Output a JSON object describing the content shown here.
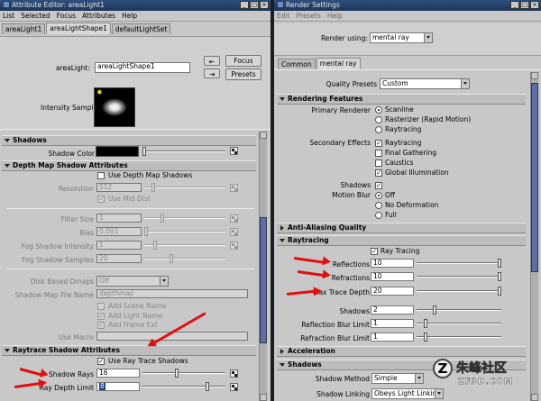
{
  "attribute_editor": {
    "title": "Attribute Editor: areaLight1",
    "menu": [
      "List",
      "Selected",
      "Focus",
      "Attributes",
      "Help"
    ],
    "tabs": [
      "areaLight1",
      "areaLightShape1",
      "defaultLightSet"
    ],
    "area_light_label": "areaLight:",
    "area_light_value": "areaLightShape1",
    "focus_button": "Focus",
    "presets_button": "Presets",
    "intensity_sample_label": "Intensity Sample",
    "shadows_section": "Shadows",
    "shadow_color_label": "Shadow Color",
    "depth_map_section": "Depth Map Shadow Attributes",
    "use_depth_map_label": "Use Depth Map Shadows",
    "resolution_label": "Resolution",
    "resolution_value": "512",
    "use_mid_dist_label": "Use Mid Dist",
    "filter_size_label": "Filter Size",
    "filter_size_value": "1",
    "bias_label": "Bias",
    "bias_value": "0.001",
    "fog_intensity_label": "Fog Shadow Intensity",
    "fog_intensity_value": "1",
    "fog_samples_label": "Fog Shadow Samples",
    "fog_samples_value": "20",
    "disk_based_label": "Disk Based Dmaps",
    "disk_based_value": "Off",
    "shadow_map_name_label": "Shadow Map File Name",
    "shadow_map_name_value": "depthmap",
    "add_scene_name_label": "Add Scene Name",
    "add_light_name_label": "Add Light Name",
    "add_frame_ext_label": "Add Frame Ext",
    "use_macro_label": "Use Macro",
    "raytrace_section": "Raytrace Shadow Attributes",
    "use_ray_trace_label": "Use Ray Trace Shadows",
    "shadow_rays_label": "Shadow Rays",
    "shadow_rays_value": "16",
    "ray_depth_label": "Ray Depth Limit",
    "ray_depth_value": "8"
  },
  "render_settings": {
    "title": "Render Settings",
    "menu": [
      "Edit",
      "Presets",
      "Help"
    ],
    "render_using_label": "Render using:",
    "render_using_value": "mental ray",
    "tabs": [
      "Common",
      "mental ray"
    ],
    "quality_presets_label": "Quality Presets",
    "quality_presets_value": "Custom",
    "rendering_features_section": "Rendering Features",
    "primary_renderer_label": "Primary Renderer",
    "primary_options": [
      "Scanline",
      "Rasterizer (Rapid Motion)",
      "Raytracing"
    ],
    "secondary_effects_label": "Secondary Effects",
    "secondary_options": [
      "Raytracing",
      "Final Gathering",
      "Caustics",
      "Global Illumination"
    ],
    "shadows_label": "Shadows",
    "motion_blur_label": "Motion Blur",
    "motion_blur_options": [
      "Off",
      "No Deformation",
      "Full"
    ],
    "anti_aliasing_section": "Anti-Aliasing Quality",
    "raytracing_section": "Raytracing",
    "ray_tracing_label": "Ray Tracing",
    "reflections_label": "Reflections",
    "reflections_value": "10",
    "refractions_label": "Refractions",
    "refractions_value": "10",
    "max_trace_depth_label": "Max Trace Depth",
    "max_trace_depth_value": "20",
    "rt_shadows_label": "Shadows",
    "rt_shadows_value": "2",
    "reflection_blur_label": "Reflection Blur Limit",
    "reflection_blur_value": "1",
    "refraction_blur_label": "Refraction Blur Limit",
    "refraction_blur_value": "1",
    "acceleration_section": "Acceleration",
    "shadows_section": "Shadows",
    "shadow_method_label": "Shadow Method",
    "shadow_method_value": "Simple",
    "shadow_linking_label": "Shadow Linking",
    "shadow_linking_value": "Obeys Light Linking"
  },
  "watermark": {
    "text": "朱峰社区",
    "url": "ZF3D.COM"
  },
  "colors": {
    "annotation_arrow": "#e01010",
    "titlebar": "#24406a",
    "scroll_handle": "#5a6fa8"
  }
}
